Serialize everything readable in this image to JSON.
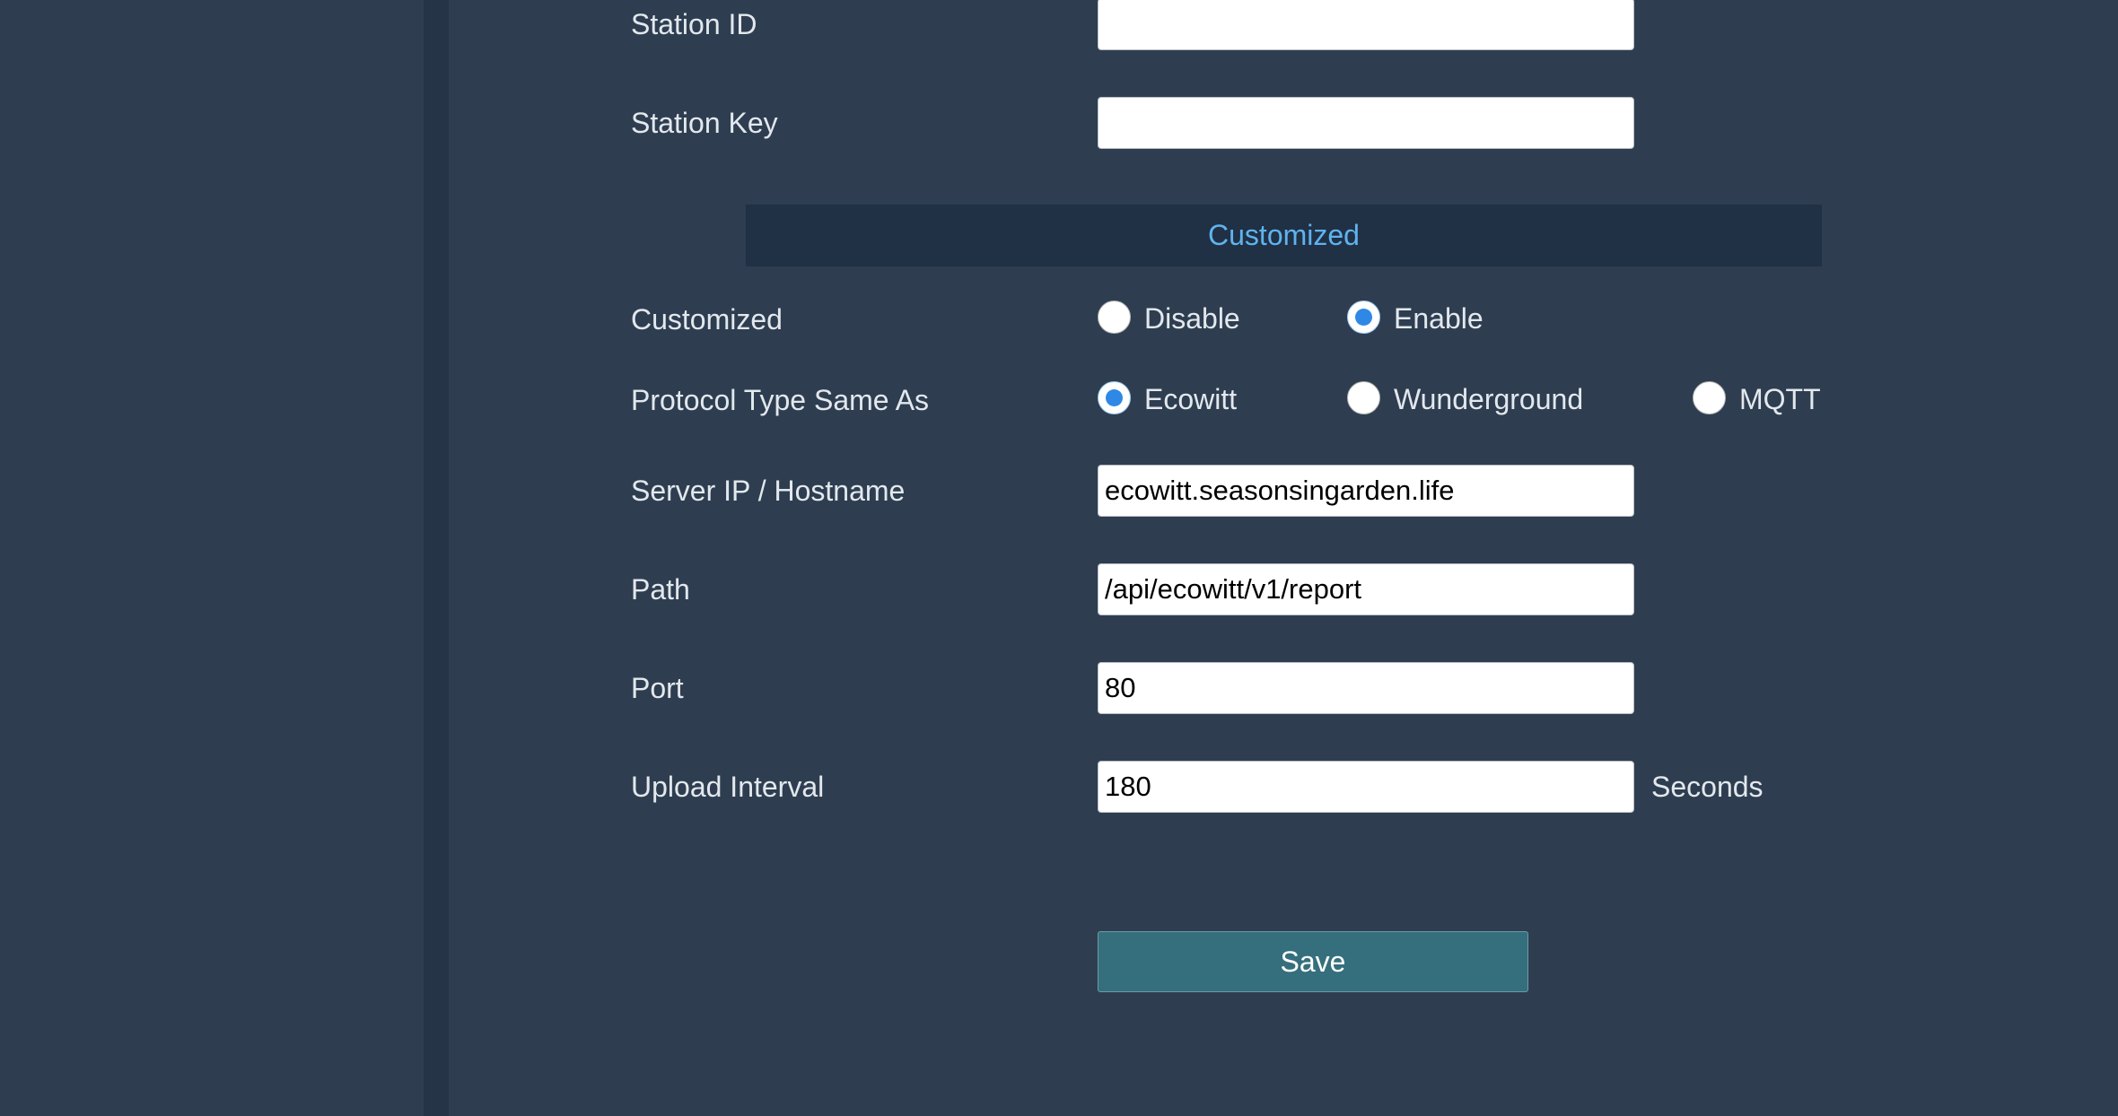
{
  "colors": {
    "background": "#2e3e50",
    "divider": "#253446",
    "section_header_bg": "#203045",
    "section_title": "#5fb3ee",
    "radio_selected": "#2f88e6",
    "save_button": "#356f7d"
  },
  "form": {
    "station_id": {
      "label": "Station ID",
      "value": ""
    },
    "station_key": {
      "label": "Station Key",
      "value": ""
    }
  },
  "customized_section": {
    "title": "Customized",
    "customized": {
      "label": "Customized",
      "options": [
        "Disable",
        "Enable"
      ],
      "selected": "Enable"
    },
    "protocol_type": {
      "label": "Protocol Type Same As",
      "options": [
        "Ecowitt",
        "Wunderground",
        "MQTT"
      ],
      "selected": "Ecowitt"
    },
    "server": {
      "label": "Server IP / Hostname",
      "value": "ecowitt.seasonsingarden.life"
    },
    "path": {
      "label": "Path",
      "value": "/api/ecowitt/v1/report"
    },
    "port": {
      "label": "Port",
      "value": "80"
    },
    "upload_interval": {
      "label": "Upload Interval",
      "value": "180",
      "unit": "Seconds"
    }
  },
  "actions": {
    "save_label": "Save"
  }
}
